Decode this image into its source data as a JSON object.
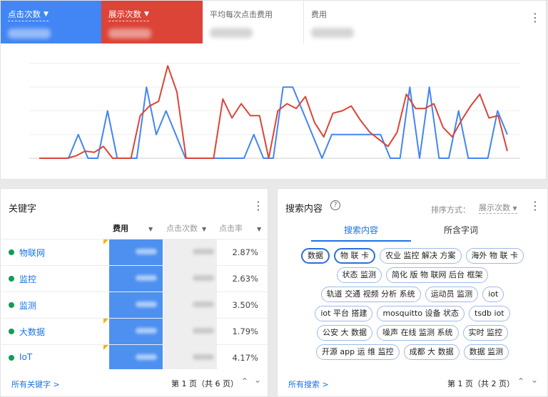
{
  "metrics": {
    "clicks_label": "点击次数",
    "impressions_label": "展示次数",
    "avg_cpc_label": "平均每次点击费用",
    "cost_label": "费用"
  },
  "chart_data": {
    "type": "line",
    "title": "",
    "series": [
      {
        "color": "#4285f4",
        "values": [
          0,
          0,
          0,
          0,
          1,
          0,
          0,
          2,
          0,
          0,
          0,
          3,
          1,
          2,
          1,
          0,
          0,
          0,
          0,
          0,
          0,
          0,
          1,
          0,
          0,
          3,
          3,
          2,
          1,
          0,
          1,
          1,
          1,
          1,
          1,
          1,
          0,
          0,
          3,
          0,
          3,
          0,
          0,
          2,
          0,
          0,
          0,
          2,
          1
        ]
      },
      {
        "color": "#db4437",
        "values": [
          0,
          0,
          0,
          0,
          0.1,
          0.3,
          0.25,
          0.5,
          0,
          0,
          0,
          1.8,
          2.2,
          2.4,
          3.9,
          2.8,
          0,
          0,
          0,
          0,
          2.5,
          1.7,
          2.3,
          1.8,
          1.8,
          0,
          2,
          2.3,
          2.1,
          2.6,
          1.5,
          0.9,
          1.9,
          2,
          2.2,
          1.6,
          1.1,
          0.8,
          0.5,
          1.1,
          2.7,
          2.1,
          2.1,
          2.3,
          1.3,
          0.9,
          1.6,
          2.2,
          2.7,
          1.7,
          1.8,
          0.3
        ]
      }
    ]
  },
  "keywords": {
    "title": "关键字",
    "columns": {
      "cost": "费用",
      "clicks": "点击次数",
      "ctr": "点击率"
    },
    "rows": [
      {
        "name": "物联网",
        "ctr": "2.87%"
      },
      {
        "name": "监控",
        "ctr": "2.63%"
      },
      {
        "name": "监测",
        "ctr": "3.50%"
      },
      {
        "name": "大数据",
        "ctr": "1.79%"
      },
      {
        "name": "IoT",
        "ctr": "4.17%"
      }
    ],
    "all_link": "所有关键字 >",
    "page": "第 1 页（共 6 页）"
  },
  "search": {
    "title": "搜索内容",
    "sort_label": "排序方式：",
    "sort_value": "展示次数",
    "tab_content": "搜索内容",
    "tab_keywords": "所含字词",
    "chip_rows": [
      [
        "数据",
        "物 联 卡",
        "农业 监控 解决 方案",
        "海外 物 联 卡"
      ],
      [
        "状态 监测",
        "简化 版 物 联网 后台 框架"
      ],
      [
        "轨道 交通 视频 分析 系统",
        "运动员 监测",
        "iot"
      ],
      [
        "iot 平台 搭建",
        "mosquitto 设备 状态",
        "tsdb iot"
      ],
      [
        "公安 大 数据",
        "噪声 在线 监测 系统",
        "实时 监控"
      ],
      [
        "开源 app 运 维 监控",
        "成都 大 数据",
        "数据 监测"
      ]
    ],
    "all_link": "所有搜索 >",
    "page": "第 1 页（共 2 页）"
  }
}
